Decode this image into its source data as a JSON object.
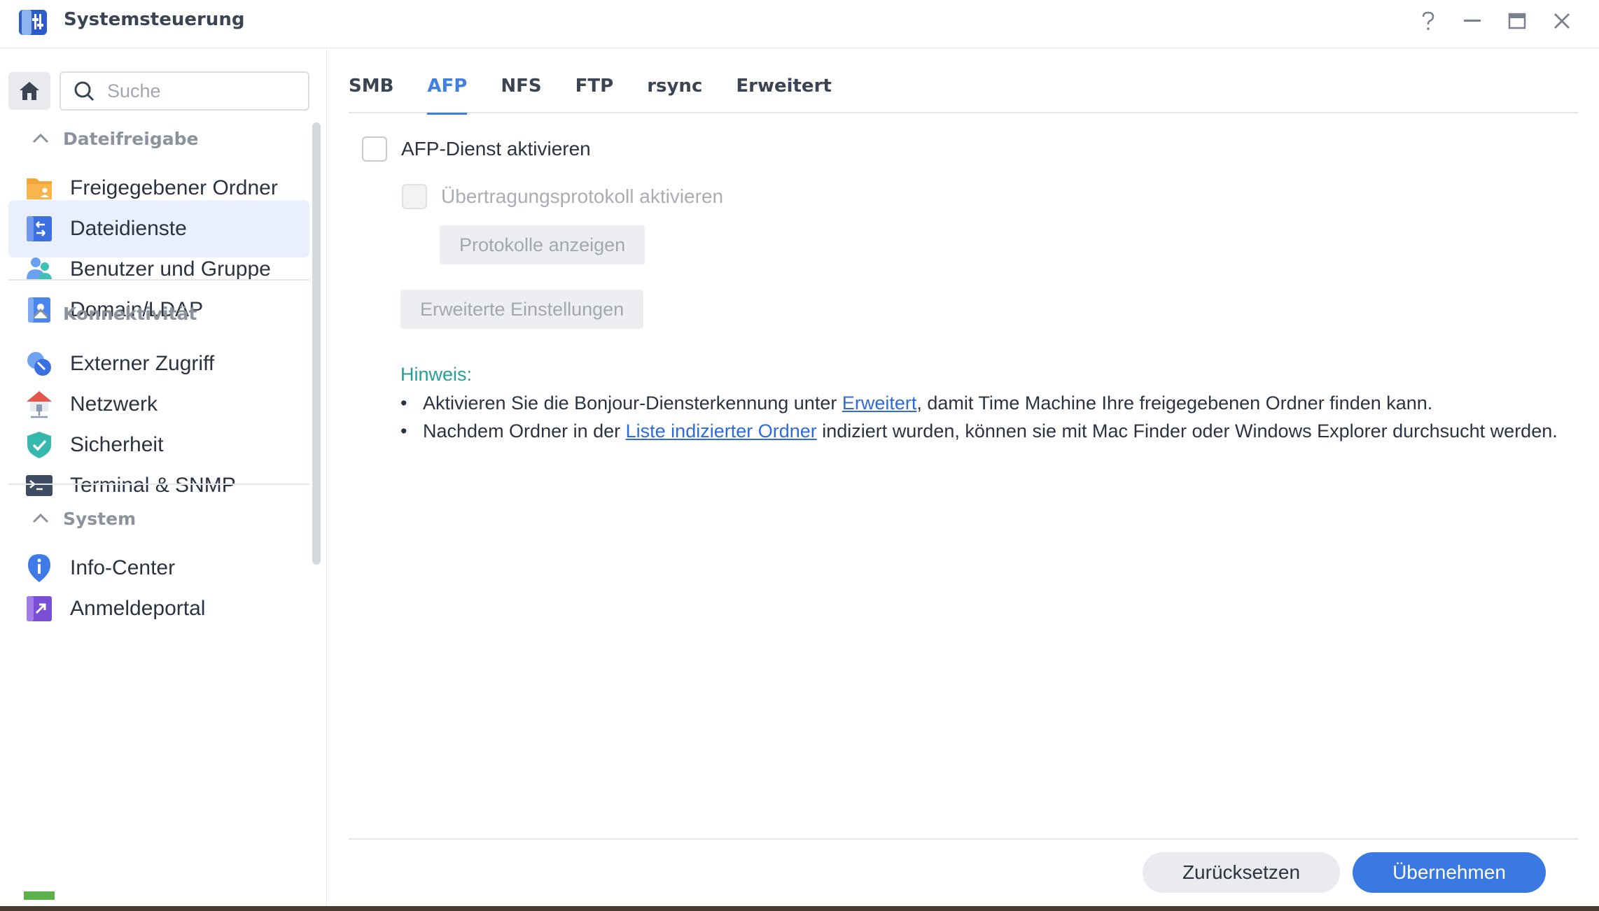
{
  "window": {
    "title": "Systemsteuerung",
    "controls": [
      "help-icon",
      "minimize-icon",
      "maximize-icon",
      "close-icon"
    ]
  },
  "sidebar": {
    "search_placeholder": "Suche",
    "sections": [
      {
        "title": "Dateifreigabe",
        "items": [
          {
            "label": "Freigegebener Ordner",
            "icon": "shared-folder-icon"
          },
          {
            "label": "Dateidienste",
            "icon": "file-services-icon",
            "active": true
          },
          {
            "label": "Benutzer und Gruppe",
            "icon": "user-group-icon"
          },
          {
            "label": "Domain/LDAP",
            "icon": "domain-ldap-icon"
          }
        ]
      },
      {
        "title": "Konnektivität",
        "items": [
          {
            "label": "Externer Zugriff",
            "icon": "external-access-icon"
          },
          {
            "label": "Netzwerk",
            "icon": "network-icon"
          },
          {
            "label": "Sicherheit",
            "icon": "security-shield-icon"
          },
          {
            "label": "Terminal & SNMP",
            "icon": "terminal-icon"
          }
        ]
      },
      {
        "title": "System",
        "items": [
          {
            "label": "Info-Center",
            "icon": "info-center-icon"
          },
          {
            "label": "Anmeldeportal",
            "icon": "login-portal-icon"
          }
        ]
      }
    ]
  },
  "main": {
    "tabs": [
      {
        "label": "SMB"
      },
      {
        "label": "AFP",
        "active": true
      },
      {
        "label": "NFS"
      },
      {
        "label": "FTP"
      },
      {
        "label": "rsync"
      },
      {
        "label": "Erweitert"
      }
    ],
    "enable_afp": {
      "label": "AFP-Dienst aktivieren",
      "checked": false
    },
    "enable_transfer_log": {
      "label": "Übertragungsprotokoll aktivieren",
      "checked": false,
      "disabled": true
    },
    "show_logs_button": "Protokolle anzeigen",
    "advanced_settings_button": "Erweiterte Einstellungen",
    "note": {
      "title": "Hinweis:",
      "item1_pre": "Aktivieren Sie die Bonjour-Diensterkennung unter ",
      "item1_link": "Erweitert",
      "item1_post": ", damit Time Machine Ihre freigegebenen Ordner finden kann.",
      "item2_pre": "Nachdem Ordner in der ",
      "item2_link": "Liste indizierter Ordner",
      "item2_post": " indiziert wurden, können sie mit Mac Finder oder Windows Explorer durchsucht werden."
    },
    "footer": {
      "reset_label": "Zurücksetzen",
      "apply_label": "Übernehmen"
    }
  },
  "colors": {
    "accent": "#3a78e2",
    "active_tab": "#3f7fe0",
    "note_title": "#25a098",
    "link": "#2e6bd9",
    "active_nav_bg": "#e9effc"
  }
}
